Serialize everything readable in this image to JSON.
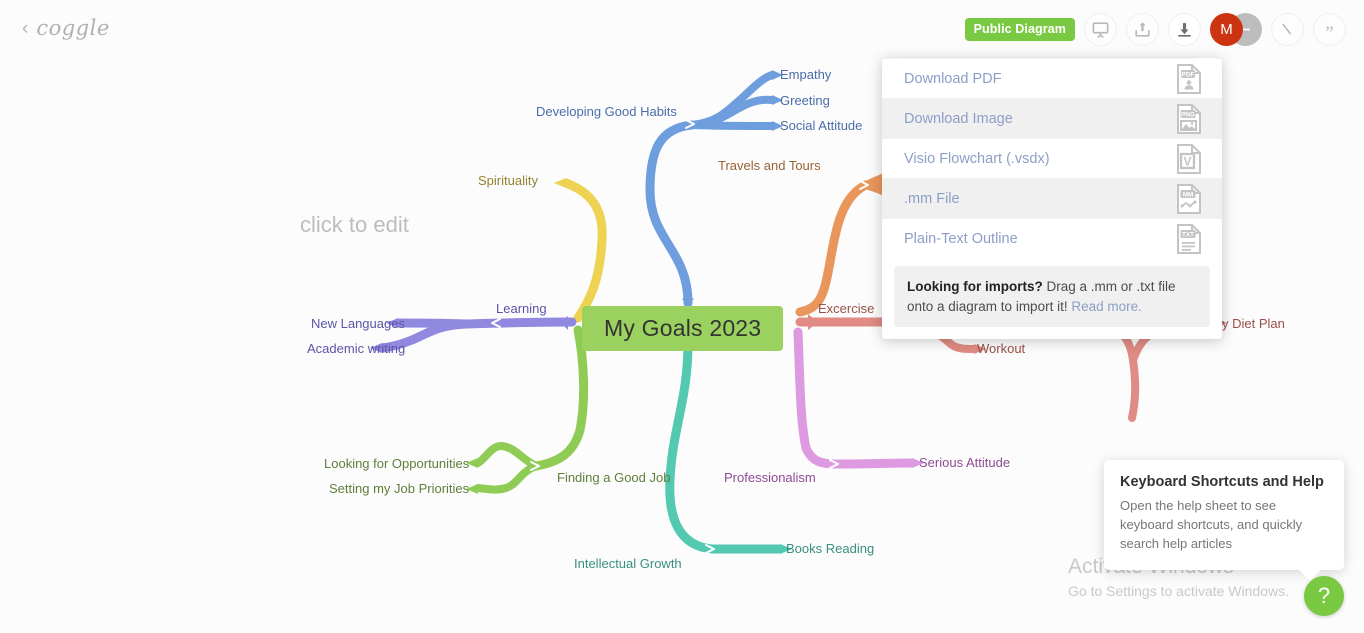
{
  "brand": {
    "back_icon": "chevron-left-icon",
    "wordmark": "coggle"
  },
  "toolbar": {
    "visibility_badge": "Public Diagram",
    "buttons": [
      {
        "name": "presentation-icon",
        "title": "Presentation mode"
      },
      {
        "name": "upload-icon",
        "title": "Share / Upload"
      },
      {
        "name": "download-icon",
        "title": "Download"
      },
      {
        "name": "pen-icon",
        "title": "Drawing"
      },
      {
        "name": "quote-icon",
        "title": "Comments"
      }
    ],
    "avatars": [
      {
        "initial": "M",
        "color": "#cc3311"
      },
      {
        "initial": "",
        "color": "#bdbdbd"
      }
    ],
    "accent_green": "#7ac943"
  },
  "download_menu": {
    "items": [
      {
        "label": "Download PDF",
        "icon": "pdf-file-icon",
        "icon_text": "PDF",
        "highlighted": false
      },
      {
        "label": "Download Image",
        "icon": "png-file-icon",
        "icon_text": "PNG",
        "highlighted": true
      },
      {
        "label": "Visio Flowchart (.vsdx)",
        "icon": "visio-file-icon",
        "icon_text": "V",
        "highlighted": false
      },
      {
        "label": ".mm File",
        "icon": "mm-file-icon",
        "icon_text": "MM",
        "highlighted": true
      },
      {
        "label": "Plain-Text Outline",
        "icon": "txt-file-icon",
        "icon_text": "TXT",
        "highlighted": false
      }
    ],
    "note": {
      "strong": "Looking for imports?",
      "text": " Drag a .mm or .txt file onto a diagram to import it! ",
      "link": "Read more."
    }
  },
  "help_tooltip": {
    "title": "Keyboard Shortcuts and Help",
    "body": "Open the help sheet to see keyboard shortcuts, and quickly search help articles",
    "fab_label": "?"
  },
  "watermark": {
    "title": "Activate Windows",
    "subtitle": "Go to Settings to activate Windows."
  },
  "canvas": {
    "placeholder": "click to edit"
  },
  "mindmap": {
    "central": {
      "text": "My Goals 2023",
      "fill": "#9bd15f",
      "text_color": "#333333"
    },
    "branches": [
      {
        "label": "Developing Good Habits",
        "color": "#6f9ede",
        "text_color": "#4a6ea9",
        "children": [
          {
            "label": "Empathy",
            "color": "#6f9ede",
            "text_color": "#4a6ea9"
          },
          {
            "label": "Greeting",
            "color": "#6f9ede",
            "text_color": "#4a6ea9"
          },
          {
            "label": "Social Attitude",
            "color": "#6f9ede",
            "text_color": "#4a6ea9"
          }
        ]
      },
      {
        "label": "Spirituality",
        "color": "#eed252",
        "text_color": "#938331",
        "children": []
      },
      {
        "label": "Learning",
        "color": "#9188e0",
        "text_color": "#5c54a8",
        "children": [
          {
            "label": "New Languages",
            "color": "#9188e0",
            "text_color": "#5c54a8"
          },
          {
            "label": "Academic writing",
            "color": "#9188e0",
            "text_color": "#5c54a8"
          }
        ]
      },
      {
        "label": "Finding a Good Job",
        "color": "#8fcc56",
        "text_color": "#5f7f3a",
        "children": [
          {
            "label": "Looking for Opportunities",
            "color": "#8fcc56",
            "text_color": "#5f7f3a"
          },
          {
            "label": "Setting my Job Priorities",
            "color": "#8fcc56",
            "text_color": "#5f7f3a"
          }
        ]
      },
      {
        "label": "Intellectual Growth",
        "color": "#53c9b0",
        "text_color": "#3a8f7e",
        "children": [
          {
            "label": "Books Reading",
            "color": "#53c9b0",
            "text_color": "#3a8f7e"
          }
        ]
      },
      {
        "label": "Professionalism",
        "color": "#dd9ae0",
        "text_color": "#8e4b93",
        "children": [
          {
            "label": "Serious Attitude",
            "color": "#dd9ae0",
            "text_color": "#8e4b93"
          }
        ]
      },
      {
        "label": "Excercise",
        "color": "#e08b84",
        "text_color": "#9a5149",
        "children": [
          {
            "label": "Workout",
            "color": "#e08b84",
            "text_color": "#9a5149"
          },
          {
            "label": "y Diet Plan",
            "color": "#e08b84",
            "text_color": "#9a5149"
          }
        ]
      },
      {
        "label": "Travels and Tours",
        "color": "#e8965b",
        "text_color": "#9a6336",
        "children": []
      }
    ]
  }
}
